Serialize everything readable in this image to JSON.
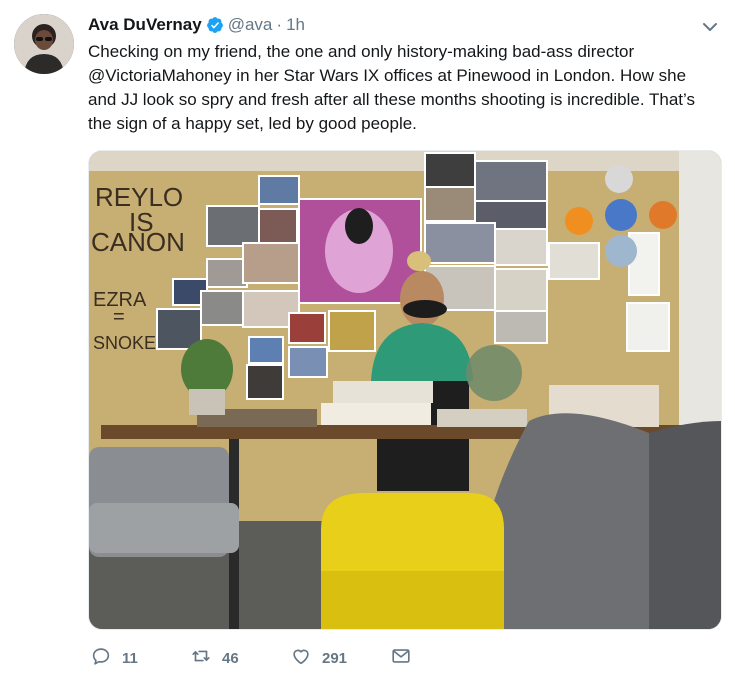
{
  "author": {
    "name": "Ava DuVernay",
    "handle": "@ava",
    "separator": "·",
    "time": "1h",
    "verified_icon": "verified-badge-icon"
  },
  "tweet": {
    "lines": [
      "Checking on my friend, the one and only history-making bad-ass director",
      "@VictoriaMahoney in her Star Wars IX offices at Pinewood in London. How she",
      "and JJ look so spry and fresh after all these months shooting is incredible. That’s",
      "the sign of a happy set, led by good people."
    ],
    "mention": "@VictoriaMahoney"
  },
  "photo": {
    "wall_text_1": "REYLO",
    "wall_text_2": "IS",
    "wall_text_3": "CANON",
    "wall_text_4": "EZRA",
    "wall_text_5": "=",
    "wall_text_6": "SNOKE"
  },
  "actions": {
    "reply_count": "11",
    "retweet_count": "46",
    "like_count": "291"
  },
  "colors": {
    "accent": "#1da1f2",
    "muted": "#657786",
    "text": "#14171a"
  }
}
